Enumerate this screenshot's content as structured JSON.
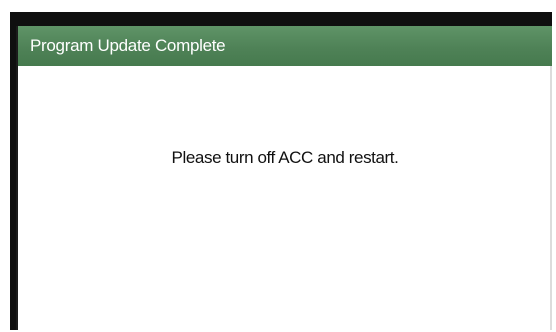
{
  "dialog": {
    "title": "Program Update Complete",
    "message": "Please turn off ACC and restart.",
    "title_bar_color": "#4f8257"
  }
}
